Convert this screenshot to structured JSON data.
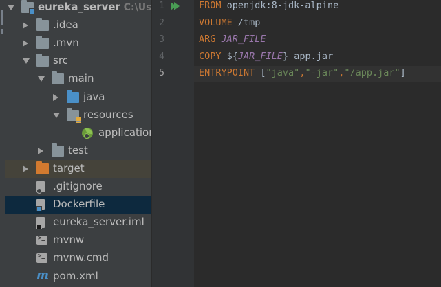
{
  "project_tree": {
    "items": [
      {
        "label": "eureka_server",
        "hint": "C:\\User",
        "icon": "module-folder-icon",
        "arrow": "down",
        "depth": 0,
        "state": ""
      },
      {
        "label": ".idea",
        "icon": "folder-icon",
        "arrow": "right",
        "depth": 1,
        "state": ""
      },
      {
        "label": ".mvn",
        "icon": "folder-icon",
        "arrow": "right",
        "depth": 1,
        "state": ""
      },
      {
        "label": "src",
        "icon": "folder-icon",
        "arrow": "down",
        "depth": 1,
        "state": ""
      },
      {
        "label": "main",
        "icon": "folder-icon",
        "arrow": "down",
        "depth": 2,
        "state": ""
      },
      {
        "label": "java",
        "icon": "source-folder-icon",
        "arrow": "right",
        "depth": 3,
        "state": ""
      },
      {
        "label": "resources",
        "icon": "resources-folder-icon",
        "arrow": "down",
        "depth": 3,
        "state": ""
      },
      {
        "label": "application",
        "icon": "spring-config-icon",
        "arrow": "",
        "depth": 4,
        "state": ""
      },
      {
        "label": "test",
        "icon": "folder-icon",
        "arrow": "right",
        "depth": 2,
        "state": ""
      },
      {
        "label": "target",
        "icon": "excluded-folder-icon",
        "arrow": "right",
        "depth": 1,
        "state": "excluded"
      },
      {
        "label": ".gitignore",
        "icon": "gitignore-file-icon",
        "arrow": "",
        "depth": 1,
        "state": ""
      },
      {
        "label": "Dockerfile",
        "icon": "dockerfile-icon",
        "arrow": "",
        "depth": 1,
        "state": "selected"
      },
      {
        "label": "eureka_server.iml",
        "icon": "iml-file-icon",
        "arrow": "",
        "depth": 1,
        "state": ""
      },
      {
        "label": "mvnw",
        "icon": "terminal-script-icon",
        "arrow": "",
        "depth": 1,
        "state": ""
      },
      {
        "label": "mvnw.cmd",
        "icon": "terminal-script-icon",
        "arrow": "",
        "depth": 1,
        "state": ""
      },
      {
        "label": "pom.xml",
        "icon": "maven-icon",
        "arrow": "",
        "depth": 1,
        "state": ""
      }
    ]
  },
  "maven_glyph": "m",
  "editor": {
    "current_line": 5,
    "lines": [
      {
        "number": "1",
        "tokens": [
          {
            "t": "FROM",
            "c": "kw"
          },
          {
            "t": " openjdk:8-jdk-alpine",
            "c": ""
          }
        ]
      },
      {
        "number": "2",
        "tokens": [
          {
            "t": "VOLUME",
            "c": "kw"
          },
          {
            "t": " /tmp",
            "c": ""
          }
        ]
      },
      {
        "number": "3",
        "tokens": [
          {
            "t": "ARG",
            "c": "kw"
          },
          {
            "t": " ",
            "c": ""
          },
          {
            "t": "JAR_FILE",
            "c": "var"
          }
        ]
      },
      {
        "number": "4",
        "tokens": [
          {
            "t": "COPY",
            "c": "kw"
          },
          {
            "t": " ${",
            "c": ""
          },
          {
            "t": "JAR_FILE",
            "c": "var"
          },
          {
            "t": "} app.jar",
            "c": ""
          }
        ]
      },
      {
        "number": "5",
        "tokens": [
          {
            "t": "ENTRYPOINT",
            "c": "kw"
          },
          {
            "t": " [",
            "c": ""
          },
          {
            "t": "\"java\"",
            "c": "str"
          },
          {
            "t": ",",
            "c": "kw"
          },
          {
            "t": "\"-jar\"",
            "c": "str"
          },
          {
            "t": ",",
            "c": "kw"
          },
          {
            "t": "\"/app.jar\"",
            "c": "str"
          },
          {
            "t": "]",
            "c": ""
          }
        ]
      }
    ]
  },
  "colors": {
    "keyword": "#cc7832",
    "variable": "#9876aa",
    "string": "#6a8759",
    "text": "#a9b7c6",
    "selection": "#0d293e",
    "run": "#499c54"
  }
}
